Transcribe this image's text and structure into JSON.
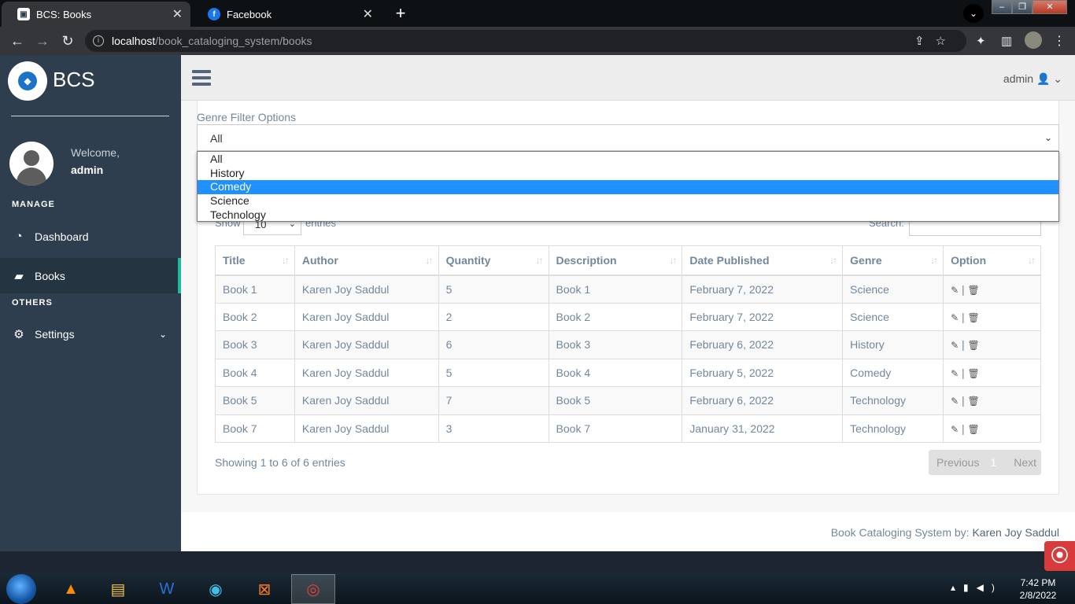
{
  "browser": {
    "tabs": [
      {
        "title": "BCS: Books",
        "active": true
      },
      {
        "title": "Facebook",
        "active": false
      }
    ],
    "url_host": "localhost",
    "url_path": "/book_cataloging_system/books"
  },
  "sidebar": {
    "brand": "BCS",
    "welcome": "Welcome,",
    "username": "admin",
    "sections": [
      {
        "heading": "MANAGE",
        "items": [
          {
            "label": "Dashboard",
            "icon": "dashboard-icon"
          },
          {
            "label": "Books",
            "icon": "book-icon",
            "active": true
          }
        ]
      },
      {
        "heading": "OTHERS",
        "items": [
          {
            "label": "Settings",
            "icon": "gear-icon"
          }
        ]
      }
    ]
  },
  "topbar": {
    "user": "admin"
  },
  "filter": {
    "label": "Genre Filter Options",
    "selected": "All",
    "options": [
      "All",
      "History",
      "Comedy",
      "Science",
      "Technology"
    ],
    "highlighted": "Comedy"
  },
  "datatable": {
    "show_label": "Show",
    "length_value": "10",
    "entries_label": "entries",
    "search_label": "Search:",
    "columns": [
      "Title",
      "Author",
      "Quantity",
      "Description",
      "Date Published",
      "Genre",
      "Option"
    ],
    "rows": [
      [
        "Book 1",
        "Karen Joy Saddul",
        "5",
        "Book 1",
        "February 7, 2022",
        "Science"
      ],
      [
        "Book 2",
        "Karen Joy Saddul",
        "2",
        "Book 2",
        "February 7, 2022",
        "Science"
      ],
      [
        "Book 3",
        "Karen Joy Saddul",
        "6",
        "Book 3",
        "February 6, 2022",
        "History"
      ],
      [
        "Book 4",
        "Karen Joy Saddul",
        "5",
        "Book 4",
        "February 5, 2022",
        "Comedy"
      ],
      [
        "Book 5",
        "Karen Joy Saddul",
        "7",
        "Book 5",
        "February 6, 2022",
        "Technology"
      ],
      [
        "Book 7",
        "Karen Joy Saddul",
        "3",
        "Book 7",
        "January 31, 2022",
        "Technology"
      ]
    ],
    "info": "Showing 1 to 6 of 6 entries",
    "pager": {
      "previous": "Previous",
      "page": "1",
      "next": "Next"
    }
  },
  "footer": {
    "prefix": "Book Cataloging System by:",
    "author": "Karen Joy Saddul"
  },
  "taskbar": {
    "time": "7:42 PM",
    "date": "2/8/2022"
  },
  "colors": {
    "sidebar": "#2e3e4e",
    "accent": "#1abc9c",
    "highlight": "#1e90ff"
  }
}
